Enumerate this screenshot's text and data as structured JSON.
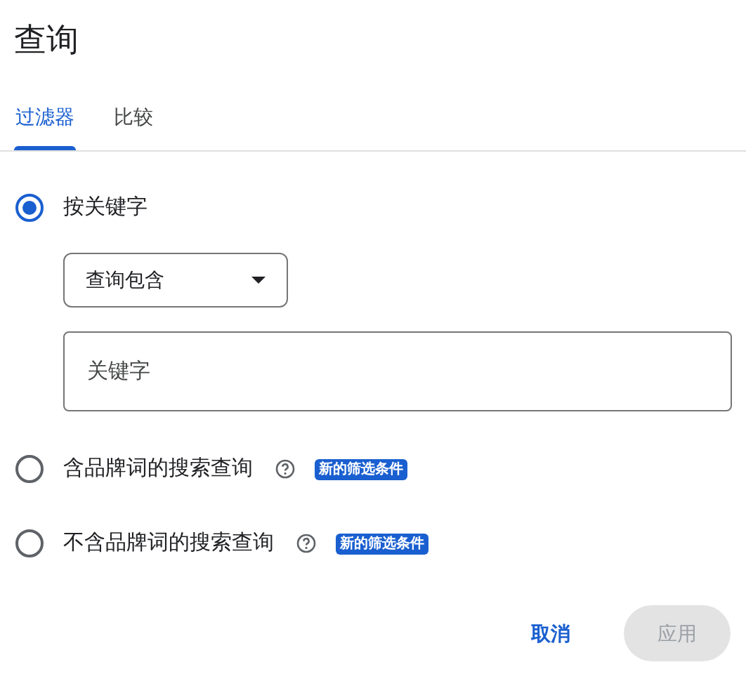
{
  "title": "查询",
  "tabs": [
    {
      "label": "过滤器",
      "selected": true
    },
    {
      "label": "比较",
      "selected": false
    }
  ],
  "options": [
    {
      "label": "按关键字",
      "selected": true,
      "dropdown": {
        "value": "查询包含"
      },
      "field": {
        "placeholder": "关键字"
      }
    },
    {
      "label": "含品牌词的搜索查询",
      "selected": false,
      "help": true,
      "badge": "新的筛选条件"
    },
    {
      "label": "不含品牌词的搜索查询",
      "selected": false,
      "help": true,
      "badge": "新的筛选条件"
    }
  ],
  "buttons": [
    {
      "label": "取消",
      "kind": "text",
      "disabled": false
    },
    {
      "label": "应用",
      "kind": "filled",
      "disabled": true
    }
  ]
}
